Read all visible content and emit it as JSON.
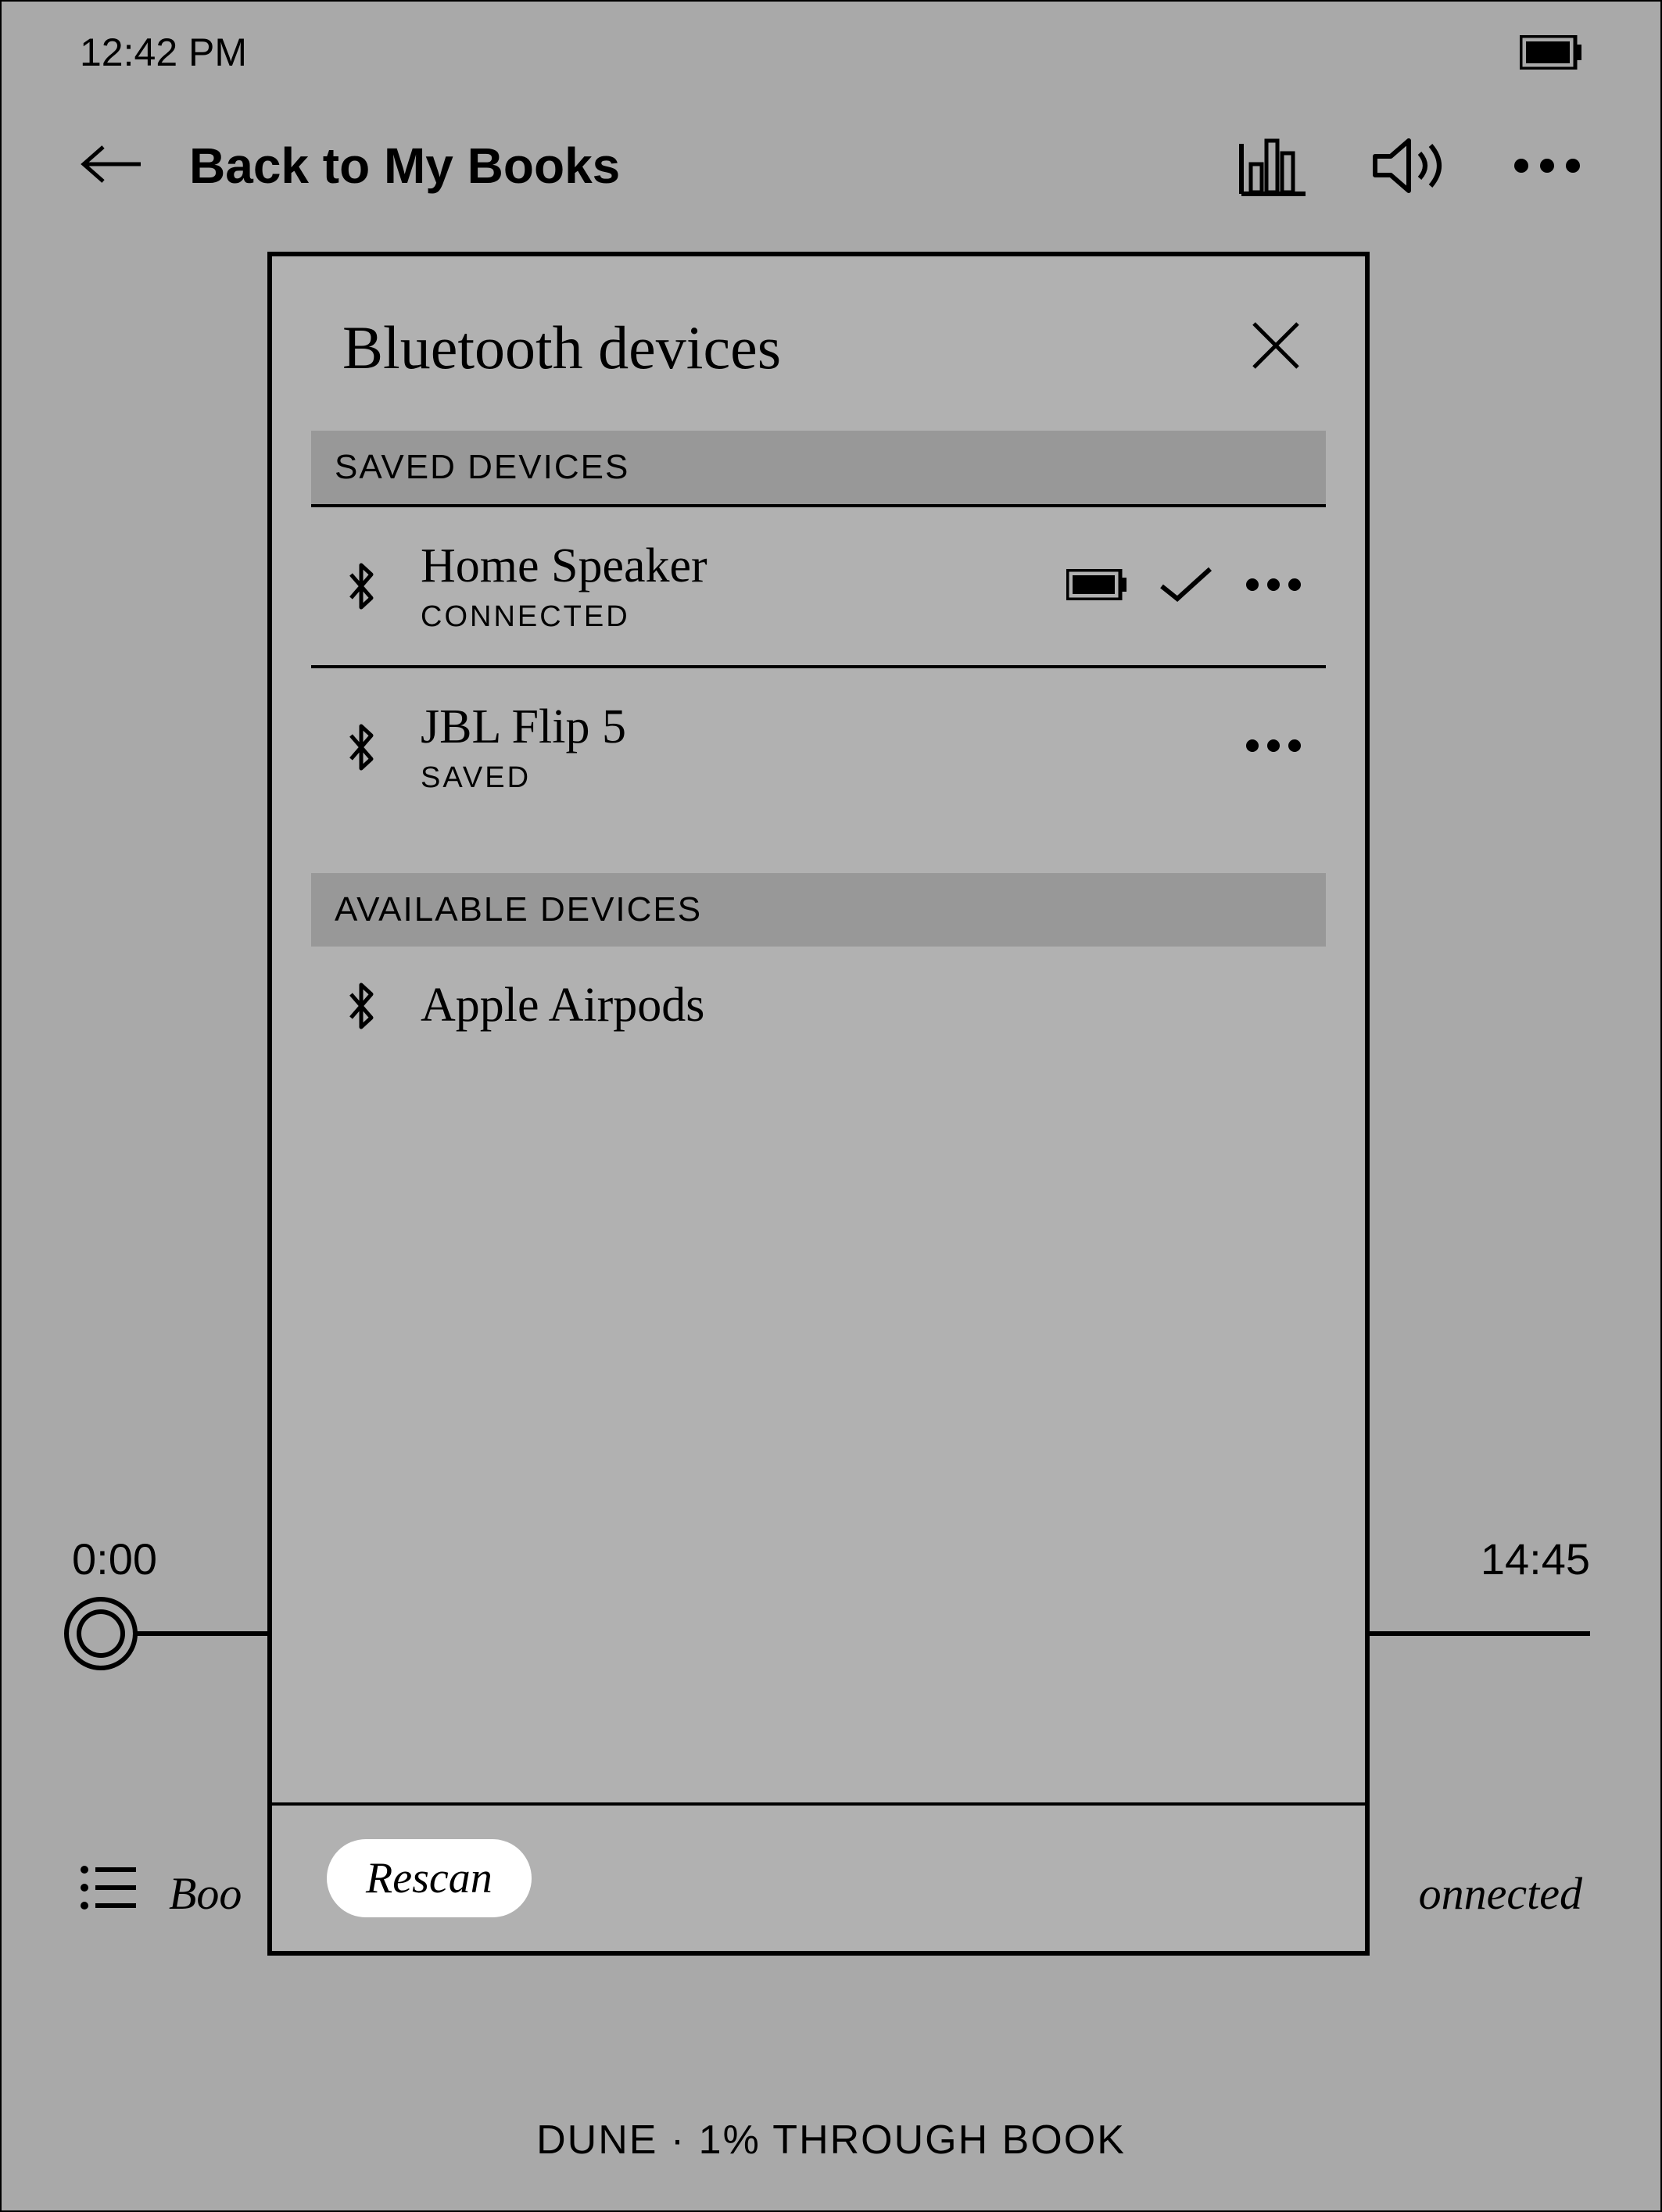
{
  "status": {
    "time": "12:42 PM"
  },
  "nav": {
    "back_label": "Back to My Books"
  },
  "playback": {
    "time_current": "0:00",
    "time_total": "14:45"
  },
  "bottom": {
    "left_truncated": "Boo",
    "right_truncated": "onnected"
  },
  "footer": {
    "text": "DUNE · 1% THROUGH BOOK"
  },
  "modal": {
    "title": "Bluetooth devices",
    "saved_header": "SAVED DEVICES",
    "available_header": "AVAILABLE DEVICES",
    "saved": [
      {
        "name": "Home Speaker",
        "status": "CONNECTED"
      },
      {
        "name": "JBL Flip 5",
        "status": "SAVED"
      }
    ],
    "available": [
      {
        "name": "Apple Airpods"
      }
    ],
    "rescan_label": "Rescan"
  }
}
